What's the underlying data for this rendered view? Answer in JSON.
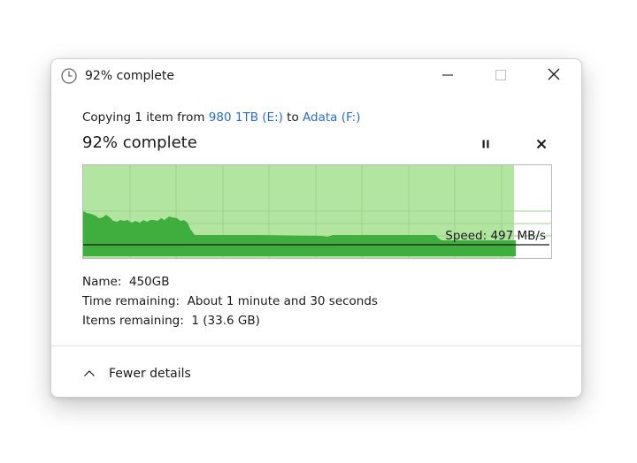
{
  "window": {
    "title": "92% complete"
  },
  "copy_line": {
    "prefix": "Copying 1 item from ",
    "source": "980 1TB (E:)",
    "middle": " to ",
    "destination": "Adata (F:)"
  },
  "progress": {
    "title": "92% complete",
    "fraction": 0.92
  },
  "graph": {
    "speed_label": "Speed: 497 MB/s"
  },
  "details": {
    "name_label": "Name:",
    "name_value": "450GB",
    "time_label": "Time remaining:",
    "time_value": "About 1 minute and 30 seconds",
    "items_label": "Items remaining:",
    "items_value": "1 (33.6 GB)"
  },
  "footer": {
    "fewer_details_label": "Fewer details"
  },
  "icons": {
    "title": "clock-icon",
    "minimize": "minimize-icon",
    "maximize": "maximize-icon",
    "close": "close-icon",
    "pause": "pause-icon",
    "cancel": "cancel-icon",
    "chevron": "chevron-up-icon"
  },
  "colors": {
    "link": "#2d6cc4",
    "graph_fill_light": "#b2e5a0",
    "graph_fill_dark": "#3fae3f",
    "graph_grid": "#9fd090",
    "speed_line": "#1a1a1a"
  }
}
